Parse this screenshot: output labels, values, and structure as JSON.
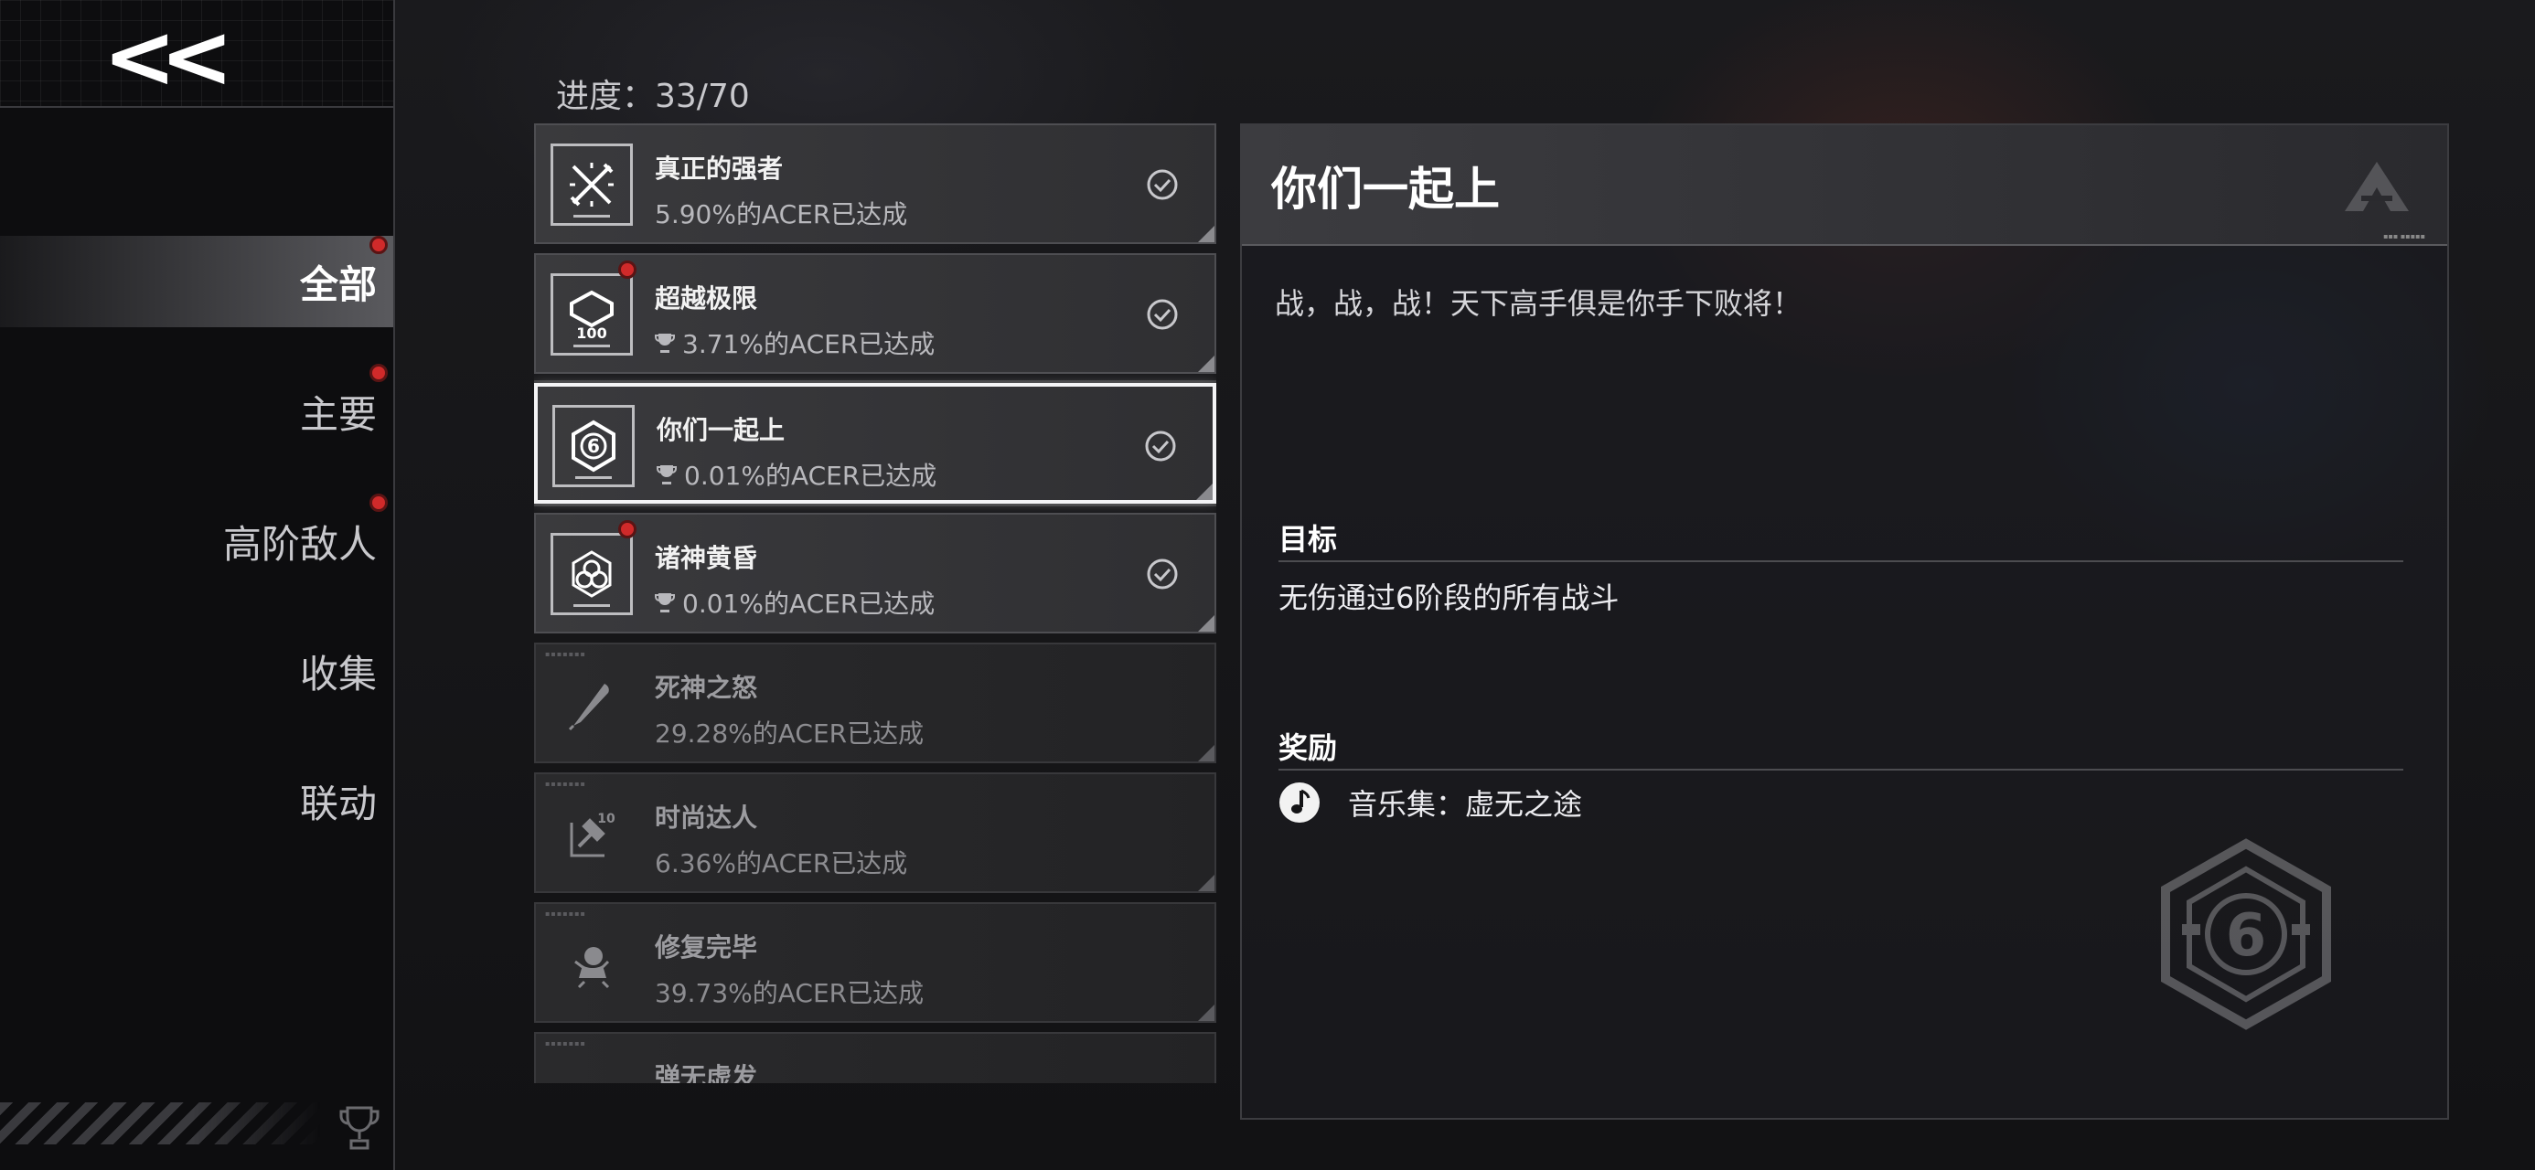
{
  "nav": {
    "back_label": "<<",
    "categories": [
      {
        "label": "全部",
        "active": true,
        "badge": true
      },
      {
        "label": "主要",
        "active": false,
        "badge": true
      },
      {
        "label": "高阶敌人",
        "active": false,
        "badge": true
      },
      {
        "label": "收集",
        "active": false,
        "badge": false
      },
      {
        "label": "联动",
        "active": false,
        "badge": false
      }
    ],
    "footer_icon": "trophy-icon"
  },
  "progress": {
    "text": "进度：33/70"
  },
  "achievements": [
    {
      "name": "真正的强者",
      "percent": "5.90%的ACER已达成",
      "completed": true,
      "new": false,
      "trophy": false,
      "icon": "crossed-swords-icon"
    },
    {
      "name": "超越极限",
      "percent": "3.71%的ACER已达成",
      "completed": true,
      "new": true,
      "trophy": true,
      "icon": "hundred-emblem-icon"
    },
    {
      "name": "你们一起上",
      "percent": "0.01%的ACER已达成",
      "completed": true,
      "new": false,
      "trophy": true,
      "selected": true,
      "icon": "six-hexagon-icon"
    },
    {
      "name": "诸神黄昏",
      "percent": "0.01%的ACER已达成",
      "completed": true,
      "new": true,
      "trophy": true,
      "icon": "triquetra-icon"
    },
    {
      "name": "死神之怒",
      "percent": "29.28%的ACER已达成",
      "completed": false,
      "new": false,
      "trophy": false,
      "icon": "feather-blade-icon"
    },
    {
      "name": "时尚达人",
      "percent": "6.36%的ACER已达成",
      "completed": false,
      "new": false,
      "trophy": false,
      "icon": "hammer-ten-icon"
    },
    {
      "name": "修复完毕",
      "percent": "39.73%的ACER已达成",
      "completed": false,
      "new": false,
      "trophy": false,
      "icon": "robot-icon"
    },
    {
      "name": "弹无虚发",
      "percent": "",
      "completed": false,
      "new": false,
      "trophy": false,
      "icon": "target-icon"
    }
  ],
  "detail": {
    "title": "你们一起上",
    "description": "战，战，战！天下高手俱是你手下败将！",
    "goal_heading": "目标",
    "goal_text": "无伤通过6阶段的所有战斗",
    "reward_heading": "奖励",
    "reward_text": "音乐集：虚无之途",
    "reward_icon": "music-note-icon",
    "badge_icon": "six-hexagon-icon",
    "badge_number": "6"
  },
  "colors": {
    "badge_red": "#d02a2a",
    "selected_border": "#f4f4f6",
    "background": "#141416"
  }
}
